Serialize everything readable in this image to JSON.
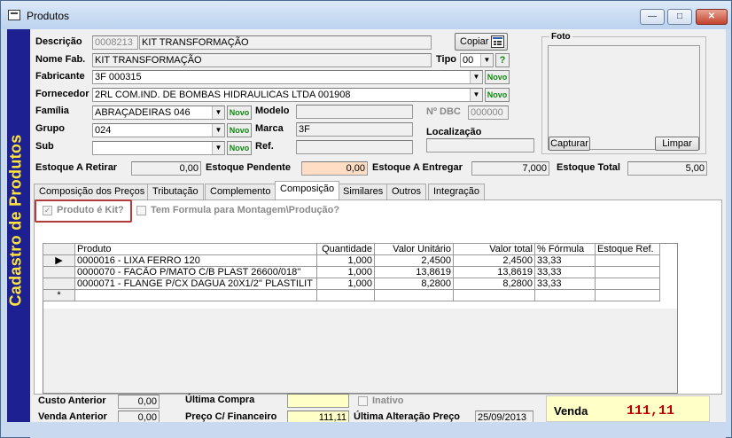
{
  "window": {
    "title": "Produtos",
    "minimize": "—",
    "maximize": "□",
    "close": "✕"
  },
  "sidebar": {
    "text": "Cadastro de Produtos"
  },
  "form": {
    "descricao_label": "Descrição",
    "codigo": "0008213",
    "descricao": "KIT TRANSFORMAÇÃO",
    "copiar_label": "Copiar",
    "nome_fab_label": "Nome Fab.",
    "nome_fab": "KIT TRANSFORMAÇÃO",
    "tipo_label": "Tipo",
    "tipo": "00",
    "help": "?",
    "fabricante_label": "Fabricante",
    "fabricante": "3F  000315",
    "novo": "Novo",
    "fornecedor_label": "Fornecedor",
    "fornecedor": "2RL COM.IND. DE BOMBAS HIDRAULICAS LTDA   001908",
    "familia_label": "Família",
    "familia": "ABRAÇADEIRAS   046",
    "modelo_label": "Modelo",
    "modelo": "",
    "dbc_label": "Nº DBC",
    "dbc": "000000",
    "grupo_label": "Grupo",
    "grupo": "024",
    "marca_label": "Marca",
    "marca": "3F",
    "localizacao_label": "Localização",
    "localizacao": "",
    "sub_label": "Sub",
    "sub": "",
    "ref_label": "Ref.",
    "ref": ""
  },
  "foto": {
    "label": "Foto",
    "capturar": "Capturar",
    "limpar": "Limpar"
  },
  "estoque": {
    "a_retirar_label": "Estoque A Retirar",
    "a_retirar": "0,00",
    "pendente_label": "Estoque Pendente",
    "pendente": "0,00",
    "a_entregar_label": "Estoque A Entregar",
    "a_entregar": "7,000",
    "total_label": "Estoque Total",
    "total": "5,00"
  },
  "tabs": [
    "Composição dos Preços",
    "Tributação",
    "Complemento",
    "Composição",
    "Similares",
    "Outros",
    "Integração"
  ],
  "composicao": {
    "produto_kit_label": "Produto é Kit?",
    "produto_kit_checked": true,
    "tem_formula_label": "Tem Formula para Montagem\\Produção?",
    "tem_formula_checked": false
  },
  "grid": {
    "columns": [
      "Produto",
      "Quantidade",
      "Valor Unitário",
      "Valor total",
      "% Fórmula",
      "Estoque Ref."
    ],
    "rows": [
      {
        "indicator": "▶",
        "produto": "0000016  -  LIXA FERRO 120",
        "quantidade": "1,000",
        "valor_unitario": "2,4500",
        "valor_total": "2,4500",
        "formula": "33,33",
        "estoque_ref": ""
      },
      {
        "indicator": "",
        "produto": "0000070  -  FACÃO P/MATO C/B PLAST 26600/018''",
        "quantidade": "1,000",
        "valor_unitario": "13,8619",
        "valor_total": "13,8619",
        "formula": "33,33",
        "estoque_ref": ""
      },
      {
        "indicator": "",
        "produto": "0000071  -  FLANGE P/CX DAGUA 20X1/2'' PLASTILIT",
        "quantidade": "1,000",
        "valor_unitario": "8,2800",
        "valor_total": "8,2800",
        "formula": "33,33",
        "estoque_ref": ""
      }
    ],
    "new_row_indicator": "*"
  },
  "footer": {
    "custo_anterior_label": "Custo  Anterior",
    "custo_anterior": "0,00",
    "venda_anterior_label": "Venda Anterior",
    "venda_anterior": "0,00",
    "ultima_compra_label": "Última Compra",
    "ultima_compra": "",
    "inativo_label": "Inativo",
    "preco_financeiro_label": "Preço C/  Financeiro",
    "preco_financeiro": "111,11",
    "ultima_alteracao_label": "Última Alteração Preço",
    "ultima_alteracao": "25/09/2013",
    "venda_label": "Venda",
    "venda": "111,11"
  },
  "colors": {
    "sidebar": "#1d2090",
    "sidebar_text": "#ffe33f",
    "venda_value": "#c00000",
    "highlight": "#b33a3a",
    "novo_text": "#128a12"
  }
}
